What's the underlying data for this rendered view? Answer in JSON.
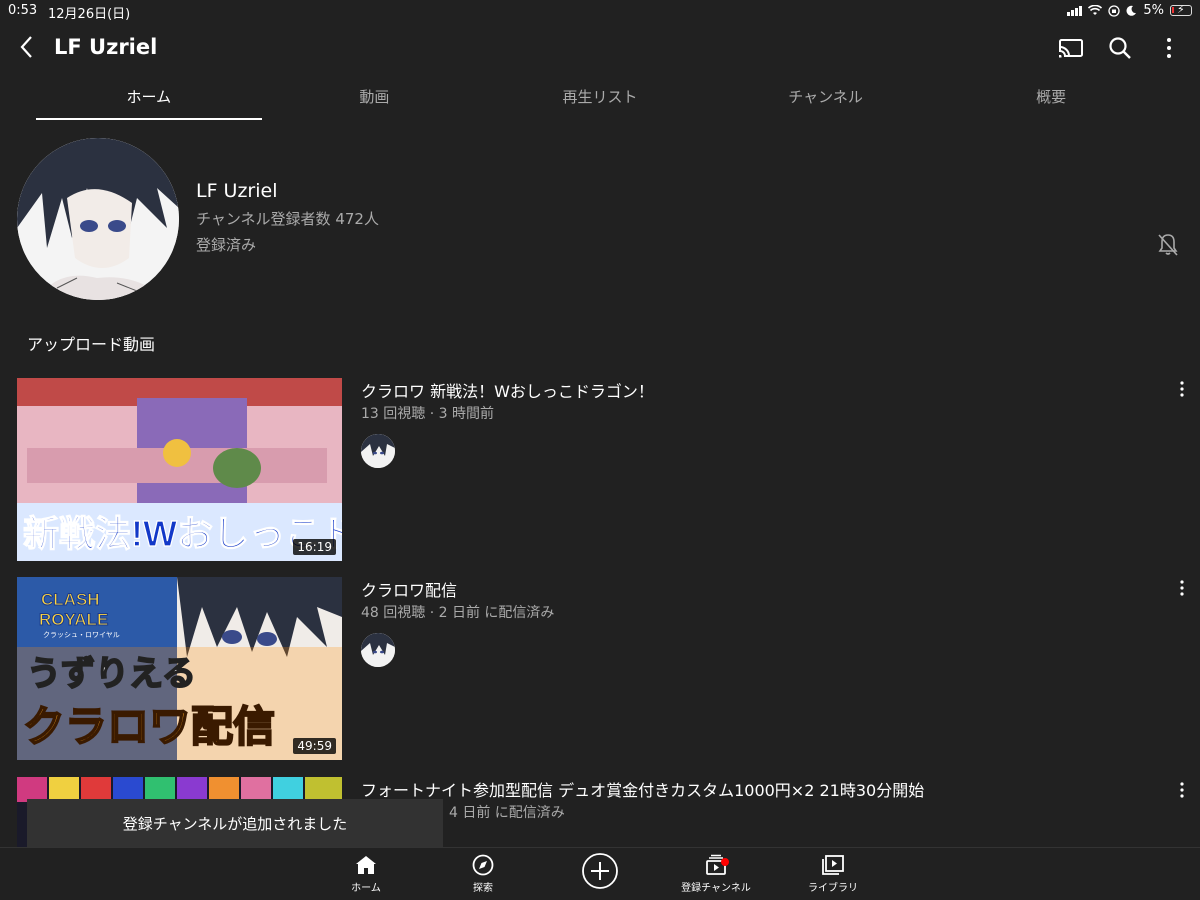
{
  "status_bar": {
    "time": "0:53",
    "date": "12月26日(日)",
    "battery": "5%"
  },
  "header": {
    "title": "LF Uzriel",
    "icons": [
      "back-icon",
      "cast-icon",
      "search-icon",
      "more-vert-icon"
    ]
  },
  "tabs": [
    {
      "label": "ホーム",
      "active": true
    },
    {
      "label": "動画",
      "active": false
    },
    {
      "label": "再生リスト",
      "active": false
    },
    {
      "label": "チャンネル",
      "active": false
    },
    {
      "label": "概要",
      "active": false
    }
  ],
  "channel": {
    "name": "LF Uzriel",
    "subscribers": "チャンネル登録者数 472人",
    "subscribed_label": "登録済み"
  },
  "section": {
    "title": "アップロード動画"
  },
  "videos": [
    {
      "title": "クラロワ 新戦法！Wおしっこドラゴン！",
      "meta": "13 回視聴 · 3 時間前",
      "duration": "16:19",
      "thumb_text": "新戦法!Wおしっこドラゴン"
    },
    {
      "title": "クラロワ配信",
      "meta": "48 回視聴 · 2 日前 に配信済み",
      "duration": "49:59",
      "thumb_logo_1": "CLASH",
      "thumb_logo_2": "ROYALE",
      "thumb_sub": "クラッシュ・ロワイヤル",
      "thumb_text_1": "うずりえる",
      "thumb_text_2": "クラロワ配信"
    },
    {
      "title": "フォートナイト参加型配信 デュオ賞金付きカスタム1000円×2 21時30分開始",
      "meta": "4 日前 に配信済み"
    }
  ],
  "toast": {
    "message": "登録チャンネルが追加されました"
  },
  "bottom_nav": [
    {
      "label": "ホーム",
      "icon": "home-icon"
    },
    {
      "label": "探索",
      "icon": "explore-icon"
    },
    {
      "label": "",
      "icon": "create-icon"
    },
    {
      "label": "登録チャンネル",
      "icon": "subscriptions-icon"
    },
    {
      "label": "ライブラリ",
      "icon": "library-icon"
    }
  ],
  "colors": {
    "background": "#212121",
    "secondary_text": "#aaaaaa",
    "notification_dot": "#ff0000"
  }
}
